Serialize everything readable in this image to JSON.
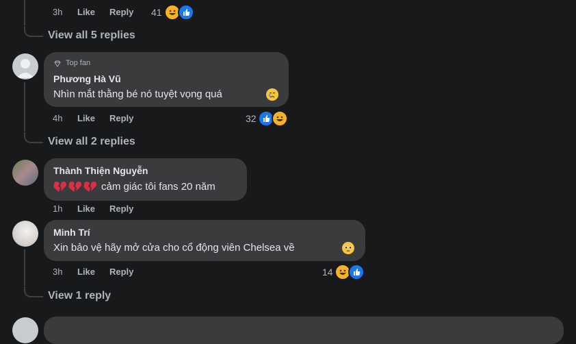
{
  "c0": {
    "time": "3h",
    "like_label": "Like",
    "reply_label": "Reply",
    "count": "41",
    "view_replies": "View all 5 replies"
  },
  "c1": {
    "badge": "Top fan",
    "author": "Phương Hà Vũ",
    "text": "Nhìn mắt thằng bé nó tuyệt vọng quá",
    "time": "4h",
    "like_label": "Like",
    "reply_label": "Reply",
    "count": "32",
    "view_replies": "View all 2 replies"
  },
  "c2": {
    "author": "Thành Thiện Nguyễn",
    "text": "cảm giác tôi fans 20 năm",
    "time": "1h",
    "like_label": "Like",
    "reply_label": "Reply"
  },
  "c3": {
    "author": "Minh Trí",
    "text": "Xin bảo vệ hãy mở cửa cho cổ động viên Chelsea về",
    "time": "3h",
    "like_label": "Like",
    "reply_label": "Reply",
    "count": "14",
    "view_replies": "View 1 reply"
  },
  "colors": {
    "background": "#18191a",
    "bubble": "#3a3b3c",
    "like_blue": "#1877f2",
    "haha_yellow": "#f7b125",
    "muted": "#b0b3b8"
  }
}
